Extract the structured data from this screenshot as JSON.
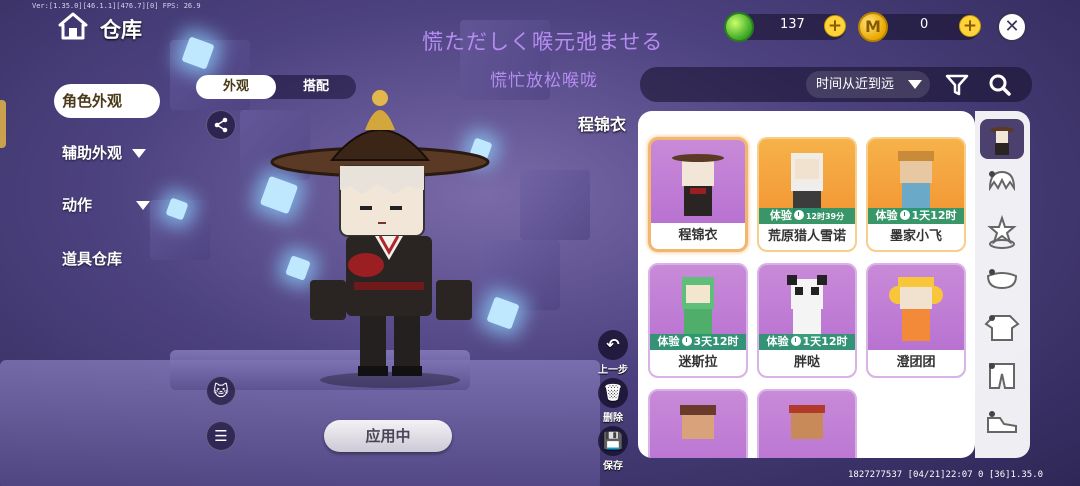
{
  "debug_text": "Ver:[1.35.0][46.1.1][476.7][0] FPS: 26.9",
  "header": {
    "title": "仓库"
  },
  "overlay_text": {
    "line1": "慌ただしく喉元弛ませる",
    "line2": "慌忙放松喉咙"
  },
  "currency": {
    "gems": "137",
    "coins": "0",
    "coin_glyph": "M"
  },
  "nav": {
    "items": [
      {
        "label": "角色外观",
        "active": true
      },
      {
        "label": "辅助外观",
        "has_dropdown": true
      },
      {
        "label": "动作",
        "has_dropdown": true
      },
      {
        "label": "道具仓库"
      }
    ]
  },
  "subtabs": [
    "外观",
    "搭配"
  ],
  "apply_button": "应用中",
  "tools": {
    "undo": "上一步",
    "delete": "删除",
    "save": "保存"
  },
  "sort": {
    "label": "时间从近到远"
  },
  "selected_name": "程锦衣",
  "skins": [
    {
      "name": "程锦衣",
      "color": "purple",
      "selected": true
    },
    {
      "name": "荒原猎人雪诺",
      "color": "orange",
      "trial_prefix": "体验",
      "trial_time": "12时39分"
    },
    {
      "name": "墨家小飞",
      "color": "orange",
      "trial_prefix": "体验",
      "trial_time": "1天12时"
    },
    {
      "name": "迷斯拉",
      "color": "purple",
      "trial_prefix": "体验",
      "trial_time": "3天12时"
    },
    {
      "name": "胖哒",
      "color": "purple",
      "trial_prefix": "体验",
      "trial_time": "1天12时"
    },
    {
      "name": "澄团团",
      "color": "purple"
    },
    {
      "name": "",
      "color": "purple"
    },
    {
      "name": "",
      "color": "purple"
    }
  ],
  "rail_icons": [
    "character-icon",
    "hair-icon",
    "face-icon",
    "mask-icon",
    "top-icon",
    "pants-icon",
    "shoes-icon"
  ],
  "footer": "1827277537  [04/21]22:07 0 [36]1.35.0"
}
